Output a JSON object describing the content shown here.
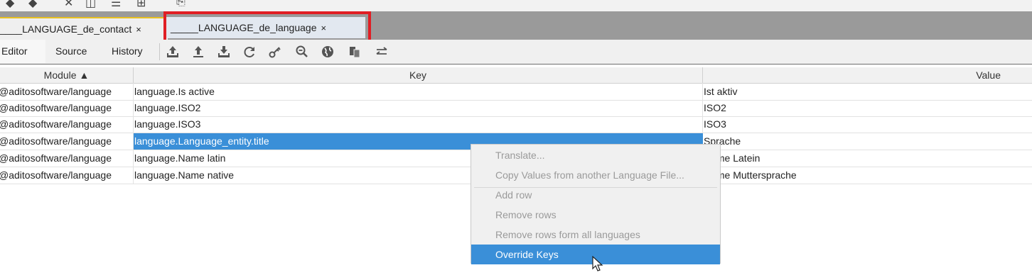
{
  "topbar_glyphs": [
    "◆",
    "◆",
    "✕",
    "◫",
    "☰",
    "⊞",
    "⎘"
  ],
  "tabs": [
    {
      "label": "____LANGUAGE_de_contact",
      "close": "×"
    },
    {
      "label": "_____LANGUAGE_de_language",
      "close": "×"
    }
  ],
  "view_tabs": [
    "Editor",
    "Source",
    "History"
  ],
  "toolbar_icons": [
    "upload-icon",
    "upload-line-icon",
    "download-icon",
    "refresh-icon",
    "key-icon",
    "zoom-out-icon",
    "globe-icon",
    "copy-icon",
    "swap-icon"
  ],
  "table": {
    "columns": [
      "Module ▲",
      "Key",
      "Value"
    ],
    "rows": [
      {
        "module": "@aditosoftware/language",
        "key": "language.Is active",
        "value": "Ist aktiv"
      },
      {
        "module": "@aditosoftware/language",
        "key": "language.ISO2",
        "value": "ISO2"
      },
      {
        "module": "@aditosoftware/language",
        "key": "language.ISO3",
        "value": "ISO3"
      },
      {
        "module": "@aditosoftware/language",
        "key": "language.Language_entity.title",
        "value": "Sprache"
      },
      {
        "module": "@aditosoftware/language",
        "key": "language.Name latin",
        "value": "Name Latein"
      },
      {
        "module": "@aditosoftware/language",
        "key": "language.Name native",
        "value": "Name Muttersprache"
      }
    ]
  },
  "context_menu": {
    "items": [
      "Translate...",
      "Copy Values from another Language File...",
      "Add row",
      "Remove rows",
      "Remove rows form all languages",
      "Override Keys"
    ],
    "highlighted": "Override Keys"
  },
  "colors": {
    "selection": "#3a8fd8",
    "highlight_box": "#e01e24",
    "tab_accent": "#e8c020"
  }
}
